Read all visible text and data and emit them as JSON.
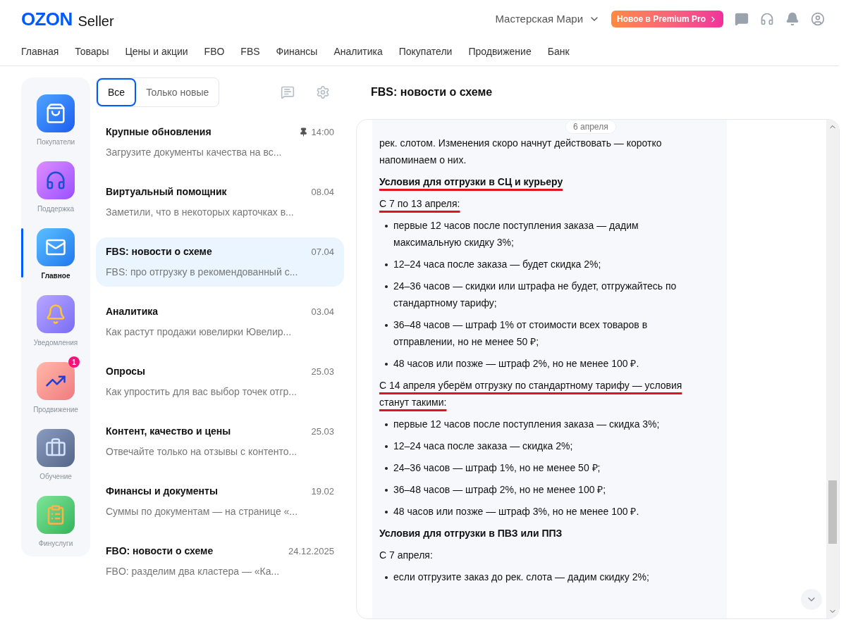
{
  "header": {
    "logo": "OZON",
    "logo_suffix": "Seller",
    "shop": "Мастерская Мари",
    "premium": "Новое в Premium Pro"
  },
  "nav": [
    "Главная",
    "Товары",
    "Цены и акции",
    "FBO",
    "FBS",
    "Финансы",
    "Аналитика",
    "Покупатели",
    "Продвижение",
    "Банк"
  ],
  "sidebar": {
    "items": [
      {
        "label": "Покупатели",
        "selected": false
      },
      {
        "label": "Поддержка",
        "selected": false
      },
      {
        "label": "Главное",
        "selected": true
      },
      {
        "label": "Уведомления",
        "selected": false
      },
      {
        "label": "Продвижение",
        "selected": false,
        "badge": "1"
      },
      {
        "label": "Обучение",
        "selected": false
      },
      {
        "label": "Финуслуги",
        "selected": false
      }
    ]
  },
  "filters": [
    {
      "label": "Все",
      "selected": true
    },
    {
      "label": "Только новые",
      "selected": false
    }
  ],
  "messages": [
    {
      "title": "Крупные обновления",
      "date": "14:00",
      "pinned": true,
      "preview": "Загрузите документы качества на вс...",
      "selected": false
    },
    {
      "title": "Виртуальный помощник",
      "date": "08.04",
      "pinned": false,
      "preview": "Заметили, что в некоторых карточках в...",
      "selected": false
    },
    {
      "title": "FBS: новости о схеме",
      "date": "07.04",
      "pinned": false,
      "preview": "FBS: про отгрузку в рекомендованный с...",
      "selected": true
    },
    {
      "title": "Аналитика",
      "date": "03.04",
      "pinned": false,
      "preview": "Как растут продажи ювелирки Ювелир...",
      "selected": false
    },
    {
      "title": "Опросы",
      "date": "25.03",
      "pinned": false,
      "preview": "Как упростить для вас выбор точек отгр...",
      "selected": false
    },
    {
      "title": "Контент, качество и цены",
      "date": "25.03",
      "pinned": false,
      "preview": "Отвечайте только на отзывы с контенто...",
      "selected": false
    },
    {
      "title": "Финансы и документы",
      "date": "19.02",
      "pinned": false,
      "preview": "Суммы по документам — на странице «...",
      "selected": false
    },
    {
      "title": "FBO: новости о схеме",
      "date": "24.12.2025",
      "pinned": false,
      "preview": "FBO: разделим два кластера — «Ка...",
      "selected": false
    }
  ],
  "article": {
    "title": "FBS: новости о схеме",
    "date_chip": "6 апреля",
    "blocks": [
      {
        "kind": "paragraph",
        "text": "рек. слотом. Изменения скоро начнут действовать — коротко напоминаем о них.",
        "marked": false
      },
      {
        "kind": "heading",
        "text": "Условия для отгрузки в СЦ и курьеру",
        "marked": true
      },
      {
        "kind": "paragraph",
        "text": "С 7 по 13 апреля:",
        "marked": true
      },
      {
        "kind": "bullet",
        "text": "первые 12 часов после поступления заказа — дадим максимальную скидку 3%;",
        "marked": false
      },
      {
        "kind": "bullet",
        "text": "12–24 часа после заказа — будет скидка 2%;",
        "marked": false
      },
      {
        "kind": "bullet",
        "text": "24–36 часов — скидки или штрафа не будет, отгружайтесь по стандартному тарифу;",
        "marked": false
      },
      {
        "kind": "bullet",
        "text": "36–48 часов — штраф 1% от стоимости всех товаров в отправлении, но не менее 50 ₽;",
        "marked": false
      },
      {
        "kind": "bullet",
        "text": "48 часов или позже — штраф 2%, но не менее 100 ₽.",
        "marked": false
      },
      {
        "kind": "paragraph",
        "text": "С 14 апреля уберём отгрузку по стандартному тарифу — условия станут такими:",
        "marked": true
      },
      {
        "kind": "bullet",
        "text": "первые 12 часов после поступления заказа — скидка 3%;",
        "marked": false
      },
      {
        "kind": "bullet",
        "text": "12–24 часа после заказа — скидка 2%;",
        "marked": false
      },
      {
        "kind": "bullet",
        "text": "24–36 часов — штраф 1%, но не менее 50 ₽;",
        "marked": false
      },
      {
        "kind": "bullet",
        "text": "36–48 часов — штраф 2%, но не менее 100 ₽;",
        "marked": false
      },
      {
        "kind": "bullet",
        "text": "48 часов или позже — штраф 3%, но не менее 100 ₽.",
        "marked": false
      },
      {
        "kind": "heading",
        "text": "Условия для отгрузки в ПВЗ или ППЗ",
        "marked": false
      },
      {
        "kind": "paragraph",
        "text": "С 7 апреля:",
        "marked": false
      },
      {
        "kind": "bullet",
        "text": "если отгрузите заказ до рек. слота — дадим скидку 2%;",
        "marked": false
      }
    ]
  }
}
